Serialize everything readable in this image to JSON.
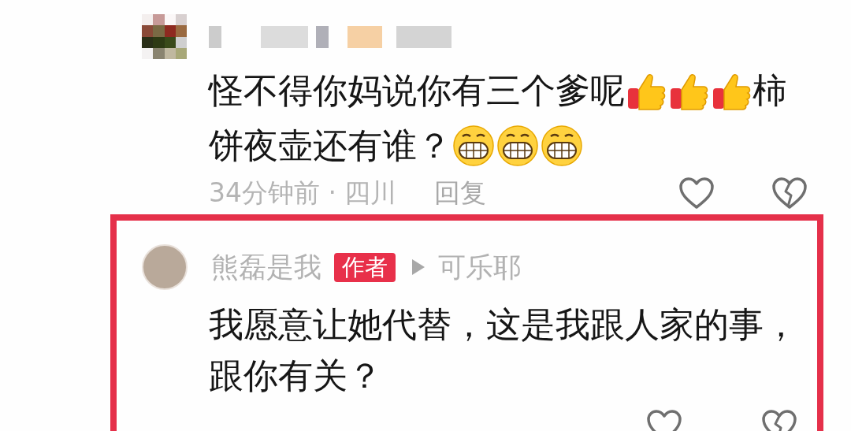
{
  "comment": {
    "text": [
      {
        "kind": "text",
        "text": "怪不得你妈说你有三个爹呢"
      },
      {
        "kind": "thumbs"
      },
      {
        "kind": "thumbs"
      },
      {
        "kind": "thumbs"
      },
      {
        "kind": "text",
        "text": "柿"
      },
      {
        "kind": "text",
        "text": "饼夜壶还有谁？"
      },
      {
        "kind": "grin"
      },
      {
        "kind": "grin"
      },
      {
        "kind": "grin"
      }
    ],
    "time_location": "34分钟前 · 四川",
    "reply_button": "回复"
  },
  "reply": {
    "author": "熊磊是我",
    "badge": "作者",
    "reply_to": "可乐耶",
    "text": "我愿意让她代替，这是我跟人家的事，跟你有关？",
    "highlighted": true
  }
}
